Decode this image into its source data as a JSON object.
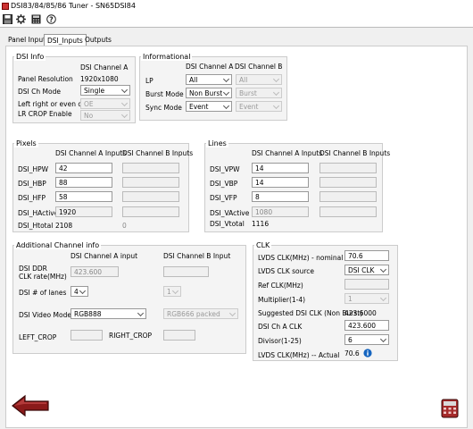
{
  "window": {
    "title": "DSI83/84/85/86 Tuner  - SN65DSI84"
  },
  "toolbar": {
    "icons": [
      "save-icon",
      "gear-icon",
      "calculator-icon",
      "help-icon"
    ]
  },
  "tabs": [
    {
      "label": "Panel Inputs"
    },
    {
      "label": "DSI_Inputs"
    },
    {
      "label": "Outputs"
    }
  ],
  "dsi_info": {
    "title": "DSI Info",
    "col_a": "DSI Channel A",
    "panel_resolution_label": "Panel Resolution",
    "panel_resolution": "1920x1080",
    "ch_mode_label": "DSI Ch Mode",
    "ch_mode": "Single",
    "left_right_label": "Left right or even odd",
    "left_right": "OE",
    "lr_crop_label": "LR CROP Enable",
    "lr_crop": "No"
  },
  "informational": {
    "title": "Informational",
    "col_a": "DSI Channel A",
    "col_b": "DSI Channel B",
    "lp_label": "LP",
    "lp_a": "All",
    "lp_b": "All",
    "burst_label": "Burst Mode",
    "burst_a": "Non Burst",
    "burst_b": "Burst",
    "sync_label": "Sync Mode",
    "sync_a": "Event",
    "sync_b": "Event"
  },
  "pixels": {
    "title": "Pixels",
    "col_a": "DSI Channel A Inputs",
    "col_b": "DSI Channel B Inputs",
    "rows": [
      {
        "label": "DSI_HPW",
        "a": "42"
      },
      {
        "label": "DSI_HBP",
        "a": "88"
      },
      {
        "label": "DSI_HFP",
        "a": "58"
      },
      {
        "label": "DSI_HActive",
        "a": "1920"
      }
    ],
    "htotal_label": "DSI_Htotal",
    "htotal_a": "2108",
    "htotal_b": "0"
  },
  "lines": {
    "title": "Lines",
    "col_a": "DSI Channel A Inputs",
    "col_b": "DSI Channel B Inputs",
    "rows": [
      {
        "label": "DSI_VPW",
        "a": "14"
      },
      {
        "label": "DSI_VBP",
        "a": "14"
      },
      {
        "label": "DSI_VFP",
        "a": "8"
      },
      {
        "label": "DSI_VActive",
        "a": "1080"
      }
    ],
    "vtotal_label": "DSI_Vtotal",
    "vtotal_a": "1116"
  },
  "additional": {
    "title": "Additional Channel info",
    "col_a": "DSI Channel A input",
    "col_b": "DSI Channel B Input",
    "ddr_label_1": "DSI DDR",
    "ddr_label_2": "CLK rate(MHz)",
    "ddr_a": "423.600",
    "lanes_label": "DSI # of lanes",
    "lanes_a": "4",
    "lanes_b": "1",
    "video_mode_label": "DSI Video Mode",
    "video_mode_a": "RGB888",
    "video_mode_b": "RGB666 packed",
    "left_crop_label": "LEFT_CROP",
    "right_crop_label": "RIGHT_CROP"
  },
  "clk": {
    "title": "CLK",
    "lvds_nominal_label": "LVDS CLK(MHz) - nominal",
    "lvds_nominal": "70.6",
    "lvds_source_label": "LVDS CLK source",
    "lvds_source": "DSI CLK",
    "ref_clk_label": "Ref CLK(MHz)",
    "multiplier_label": "Multiplier(1-4)",
    "multiplier": "1",
    "suggested_label": "Suggested DSI CLK (Non Burst)",
    "suggested": "423.6000",
    "ch_a_clk_label": "DSI Ch A CLK",
    "ch_a_clk": "423.600",
    "divisor_label": "Divisor(1-25)",
    "divisor": "6",
    "lvds_actual_label": "LVDS CLK(MHz) -- Actual",
    "lvds_actual": "70.6"
  },
  "colors": {
    "back_arrow": "#8b1a1a",
    "exit_icon": "#a52a2a",
    "info_icon": "#1565c0"
  }
}
